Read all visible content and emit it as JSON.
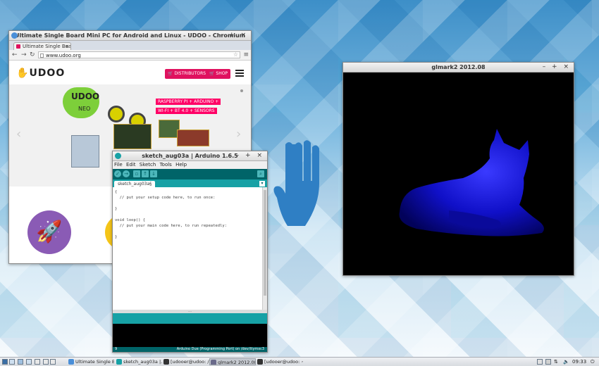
{
  "chromium": {
    "window_title": "Ultimate Single Board Mini PC for Android and Linux - UDOO - Chromium",
    "tab_label": "Ultimate Single Boa",
    "url": "www.udoo.org",
    "site": {
      "logo": "UDOO",
      "distributors_label": "DISTRIBUTORS",
      "shop_label": "SHOP",
      "hero_brand": "UDOO",
      "hero_model": "NEO",
      "hero_line1": "RASPBERRY PI + ARDUINO +",
      "hero_line2": "WI-FI + BT 4.0 + SENSORS"
    }
  },
  "arduino": {
    "window_title": "sketch_aug03a | Arduino 1.6.5",
    "menus": [
      "File",
      "Edit",
      "Sketch",
      "Tools",
      "Help"
    ],
    "tab_label": "sketch_aug03a§",
    "code_lines": [
      "{",
      "  // put your setup code here, to run once:",
      "",
      "}",
      "",
      "void loop() {",
      "  // put your main code here, to run repeatedly:",
      "",
      "}"
    ],
    "line_number": "9",
    "board_info": "Arduino Due (Programming Port) on /dev/ttymxc3"
  },
  "glmark": {
    "window_title": "glmark2 2012.08"
  },
  "window_controls": "– + ×",
  "taskbar": {
    "tasks": [
      {
        "label": "Ultimate Single B...",
        "icon": "chromium-icon"
      },
      {
        "label": "sketch_aug03a |...",
        "icon": "arduino-icon"
      },
      {
        "label": "[udooer@udoo: /]",
        "icon": "terminal-icon"
      },
      {
        "label": "glmark2 2012.08",
        "icon": "glmark-icon"
      },
      {
        "label": "[udooer@udoo: ~]",
        "icon": "terminal-icon"
      }
    ],
    "clock": "09:33"
  }
}
